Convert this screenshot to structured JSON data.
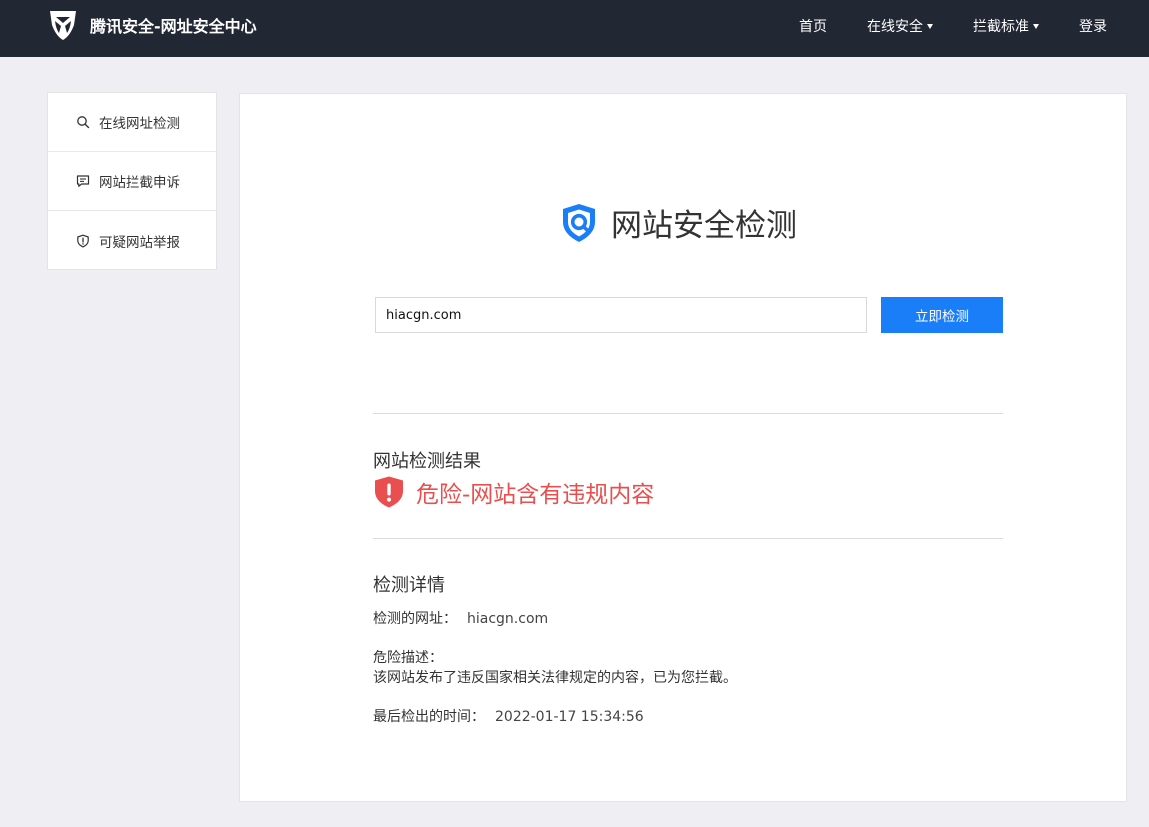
{
  "header": {
    "brand_title": "腾讯安全-网址安全中心",
    "nav": [
      {
        "label": "首页"
      },
      {
        "label": "在线安全"
      },
      {
        "label": "拦截标准"
      },
      {
        "label": "登录"
      }
    ]
  },
  "sidebar": {
    "items": [
      {
        "label": "在线网址检测",
        "icon": "search-icon"
      },
      {
        "label": "网站拦截申诉",
        "icon": "message-icon"
      },
      {
        "label": "可疑网站举报",
        "icon": "shield-alert-icon"
      }
    ]
  },
  "main": {
    "hero_title": "网站安全检测",
    "url_value": "hiacgn.com",
    "check_button": "立即检测",
    "result": {
      "title": "网站检测结果",
      "status": "危险-网站含有违规内容",
      "status_color": "#e94f4f"
    },
    "details": {
      "title": "检测详情",
      "url_label": "检测的网址：",
      "url_value": "hiacgn.com",
      "risk_label": "危险描述：",
      "risk_desc": "该网站发布了违反国家相关法律规定的内容，已为您拦截。",
      "time_label": "最后检出的时间：",
      "time_value": "2022-01-17 15:34:56"
    }
  },
  "colors": {
    "topbar": "#222734",
    "accent": "#1a7ef9",
    "danger": "#e94f4f",
    "page_bg": "#efeff3"
  }
}
